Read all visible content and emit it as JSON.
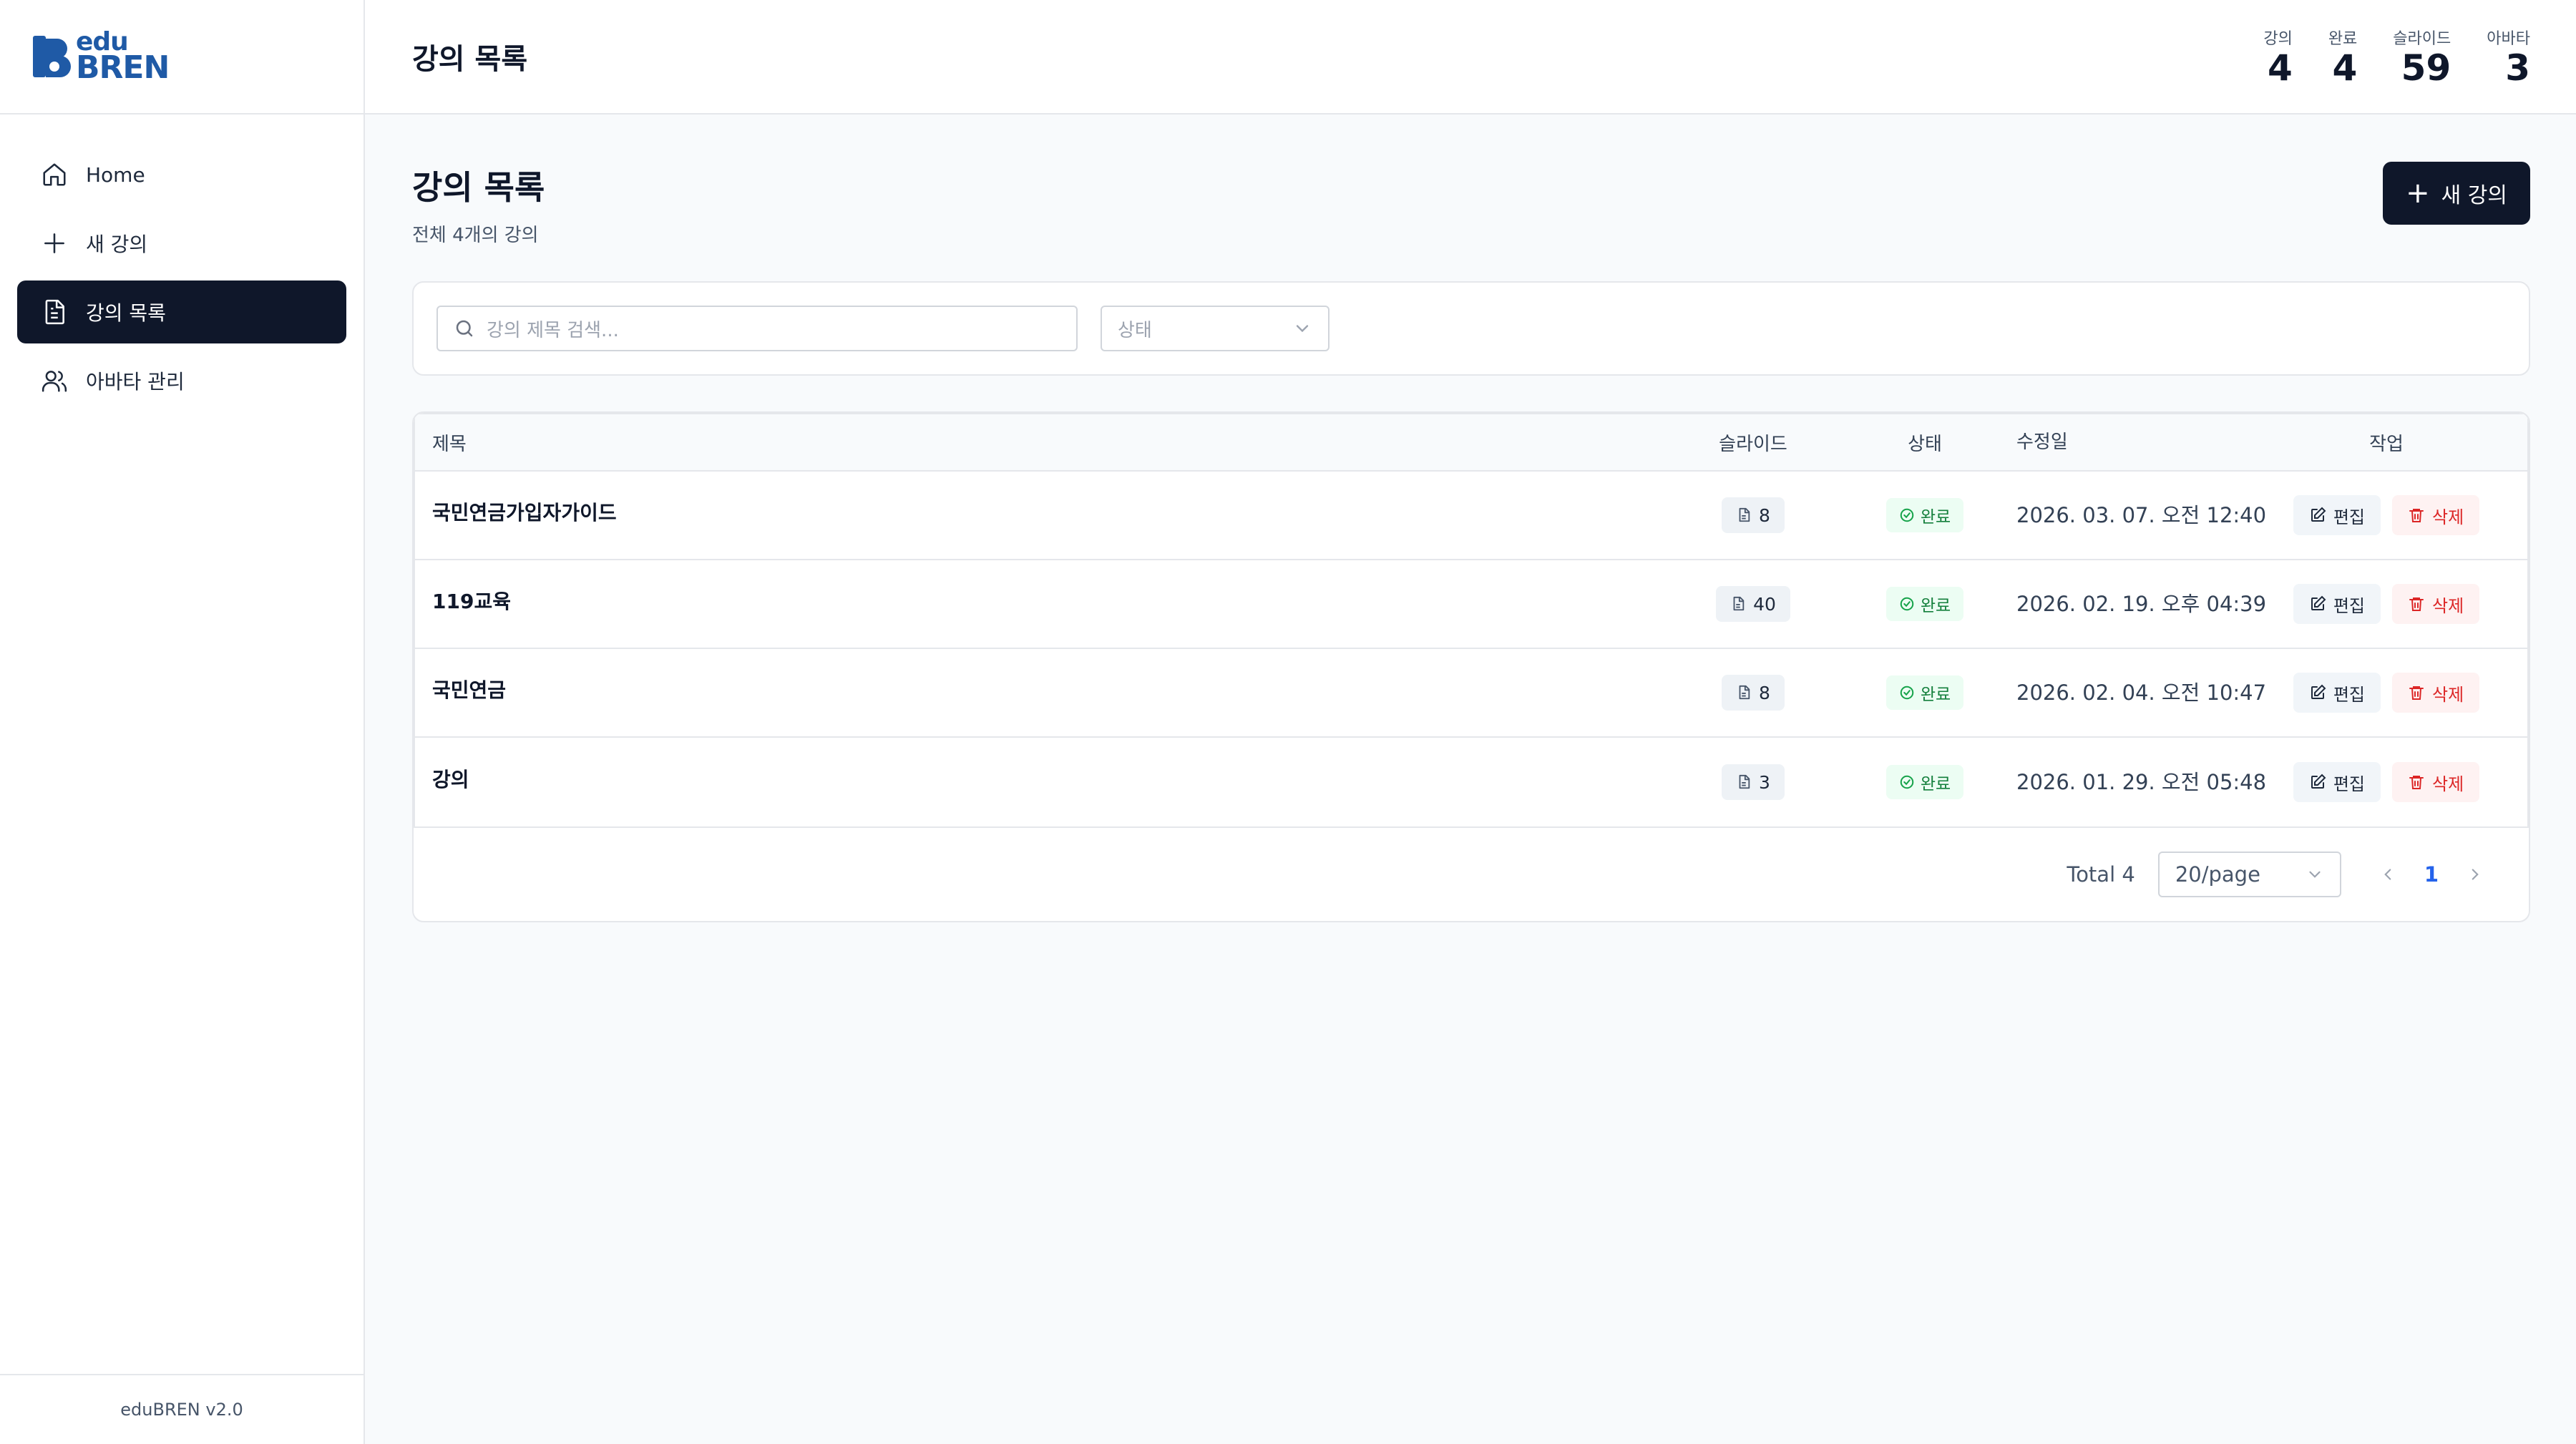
{
  "brand": {
    "line1": "edu",
    "line2": "BREN",
    "accent": "#1f5aa6"
  },
  "sidebar": {
    "items": [
      {
        "label": "Home",
        "icon": "home-icon"
      },
      {
        "label": "새 강의",
        "icon": "plus-icon"
      },
      {
        "label": "강의 목록",
        "icon": "document-icon",
        "active": true
      },
      {
        "label": "아바타 관리",
        "icon": "users-icon"
      }
    ],
    "footer": "eduBREN v2.0"
  },
  "header": {
    "title": "강의 목록",
    "stats": [
      {
        "label": "강의",
        "value": "4"
      },
      {
        "label": "완료",
        "value": "4"
      },
      {
        "label": "슬라이드",
        "value": "59"
      },
      {
        "label": "아바타",
        "value": "3"
      }
    ]
  },
  "main": {
    "title": "강의 목록",
    "subtitle": "전체 4개의 강의",
    "new_button": "새 강의",
    "search_placeholder": "강의 제목 검색...",
    "status_placeholder": "상태",
    "table": {
      "headers": {
        "title": "제목",
        "slides": "슬라이드",
        "status": "상태",
        "date": "수정일",
        "actions": "작업"
      },
      "rows": [
        {
          "title": "국민연금가입자가이드",
          "slides": "8",
          "status": "완료",
          "date": "2026. 03. 07. 오전 12:40",
          "edit": "편집",
          "delete": "삭제"
        },
        {
          "title": "119교육",
          "slides": "40",
          "status": "완료",
          "date": "2026. 02. 19. 오후 04:39",
          "edit": "편집",
          "delete": "삭제"
        },
        {
          "title": "국민연금",
          "slides": "8",
          "status": "완료",
          "date": "2026. 02. 04. 오전 10:47",
          "edit": "편집",
          "delete": "삭제"
        },
        {
          "title": "강의",
          "slides": "3",
          "status": "완료",
          "date": "2026. 01. 29. 오전 05:48",
          "edit": "편집",
          "delete": "삭제"
        }
      ]
    },
    "pagination": {
      "total": "Total 4",
      "page_size": "20/page",
      "current_page": "1"
    }
  }
}
